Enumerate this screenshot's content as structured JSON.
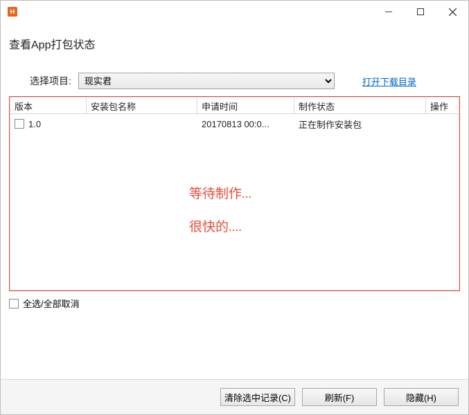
{
  "app_icon_letter": "H",
  "window_title": "查看App打包状态",
  "controls": {
    "select_label": "选择项目:",
    "project_value": "现实君",
    "download_link": "打开下载目录"
  },
  "table": {
    "headers": {
      "version": "版本",
      "pkg_name": "安装包名称",
      "apply_time": "申请时间",
      "status": "制作状态",
      "action": "操作"
    },
    "rows": [
      {
        "version": "1.0",
        "pkg_name": "",
        "apply_time": "20170813 00:0...",
        "status": "正在制作安装包",
        "action": ""
      }
    ]
  },
  "overlay": {
    "waiting": "等待制作...",
    "soon": "很快的...."
  },
  "select_all_label": "全选/全部取消",
  "footer": {
    "clear": "清除选中记录(C)",
    "refresh": "刷新(F)",
    "hide": "隐藏(H)"
  }
}
